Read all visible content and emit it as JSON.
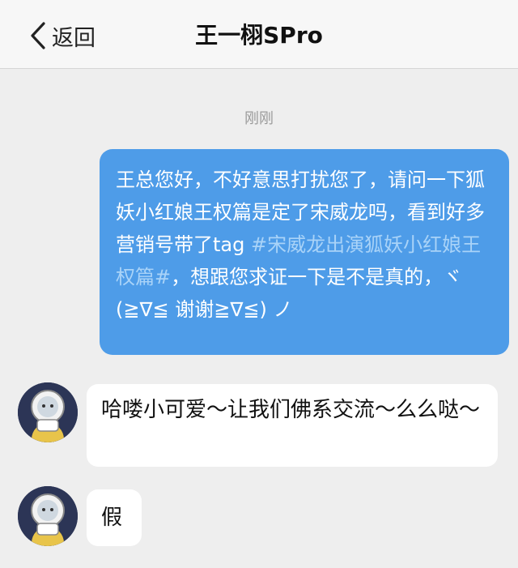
{
  "navbar": {
    "back_label": "返回",
    "title": "王一栩SPro"
  },
  "timestamp": "刚刚",
  "messages": {
    "outgoing": {
      "text_before_tag": "王总您好，不好意思打扰您了，请问一下狐妖小红娘王权篇是定了宋威龙吗，看到好多营销号带了tag ",
      "hashtag": "#宋威龙出演狐妖小红娘王权篇#",
      "text_after_tag": "，想跟您求证一下是不是真的，ヾ(≧∇≦ 谢谢≧∇≦) ノ"
    },
    "incoming": [
      {
        "text": "哈喽小可爱～让我们佛系交流～么么哒～"
      },
      {
        "text": "假"
      }
    ]
  },
  "icons": {
    "back": "chevron-left-icon",
    "avatar": "astronaut-avatar"
  },
  "colors": {
    "outgoing_bubble": "#4e9ce8",
    "hashtag": "#a9d3f8",
    "incoming_bubble": "#ffffff",
    "background": "#eeeeee"
  }
}
